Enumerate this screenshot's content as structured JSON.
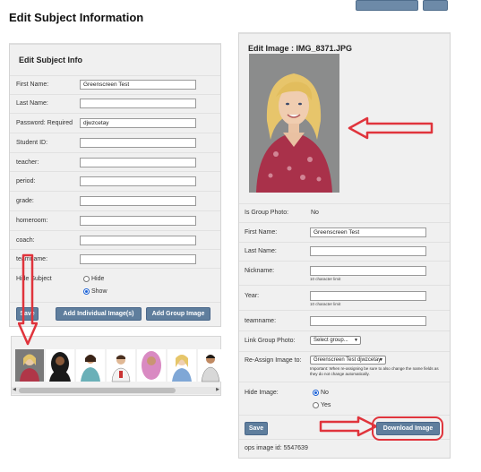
{
  "page": {
    "title": "Edit Subject Information"
  },
  "subject_form": {
    "title": "Edit Subject Info",
    "fields": [
      {
        "label": "First Name:",
        "value": "Greenscreen Test"
      },
      {
        "label": "Last Name:",
        "value": ""
      },
      {
        "label": "Password: Required",
        "value": "djwzcetay"
      },
      {
        "label": "Student ID:",
        "value": ""
      },
      {
        "label": "teacher:",
        "value": ""
      },
      {
        "label": "period:",
        "value": ""
      },
      {
        "label": "grade:",
        "value": ""
      },
      {
        "label": "homeroom:",
        "value": ""
      },
      {
        "label": "coach:",
        "value": ""
      },
      {
        "label": "teamname:",
        "value": ""
      }
    ],
    "hide_label": "Hide Subject",
    "hide_option": "Hide",
    "show_option": "Show",
    "selected": "Show",
    "save_label": "Save",
    "add_individual_label": "Add Individual Image(s)",
    "add_group_label": "Add Group Image"
  },
  "image_editor": {
    "title": "Edit Image : IMG_8371.JPG",
    "is_group_label": "Is Group Photo:",
    "is_group_value": "No",
    "first_name_label": "First Name:",
    "first_name_value": "Greenscreen Test",
    "last_name_label": "Last Name:",
    "last_name_value": "",
    "nickname_label": "Nickname:",
    "nickname_hint": "10 character limit",
    "year_label": "Year:",
    "year_hint": "10 character limit",
    "teamname_label": "teamname:",
    "link_group_label": "Link Group Photo:",
    "link_group_value": "Select group...",
    "reassign_label": "Re-Assign Image to:",
    "reassign_value": "Greenscreen Test djwzcetay",
    "reassign_note": "Important: When re-assigning be sure to also change the name fields as they do not change automatically.",
    "hide_image_label": "Hide Image:",
    "hide_no": "No",
    "hide_yes": "Yes",
    "hide_selected": "No",
    "save_label": "Save",
    "download_label": "Download Image",
    "ops_id_text": "ops image id: 5547639"
  },
  "colors": {
    "button": "#5f7e9d",
    "arrow": "#e0343c",
    "panel_bg": "#f0f0f0"
  }
}
